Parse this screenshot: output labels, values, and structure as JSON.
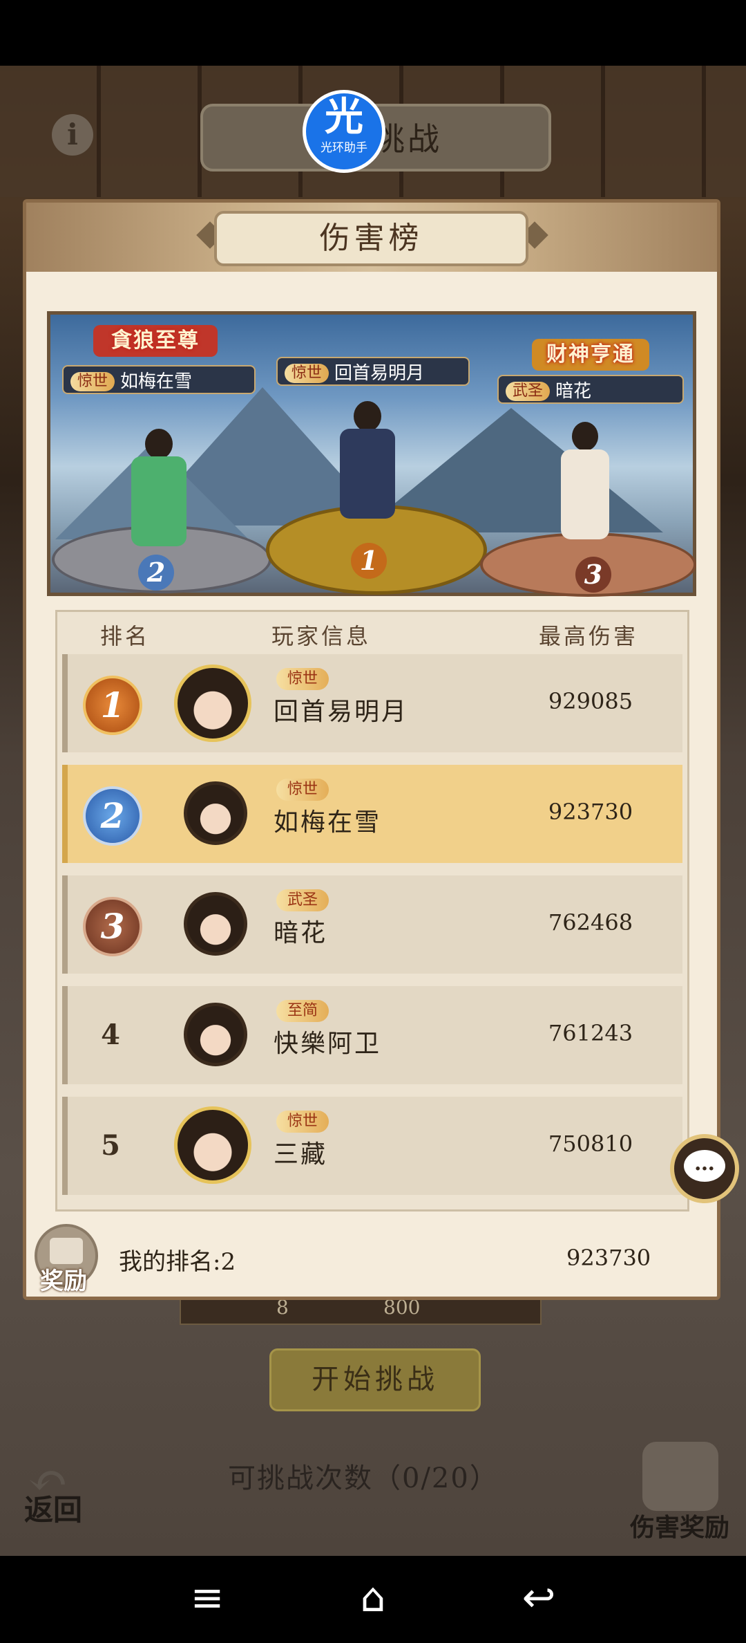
{
  "logo": {
    "big": "光",
    "small": "光环助手"
  },
  "background": {
    "title": "挑战",
    "stat_1": "8",
    "stat_2": "800",
    "start_label": "开始挑战",
    "challenge_count": "可挑战次数（0/20）",
    "back_label": "返回",
    "damage_reward_label": "伤害奖励"
  },
  "panel": {
    "title": "伤害榜",
    "podium": {
      "first": {
        "tag": "惊世",
        "name": "回首易明月",
        "medal": "1"
      },
      "second": {
        "tag": "惊世",
        "name": "如梅在雪",
        "medal": "2",
        "banner": "貪狼至尊"
      },
      "third": {
        "tag": "武圣",
        "name": "暗花",
        "medal": "3",
        "banner": "财神亨通"
      }
    },
    "columns": {
      "rank": "排名",
      "player": "玩家信息",
      "damage": "最高伤害"
    },
    "rows": [
      {
        "rank": "1",
        "tag": "惊世",
        "name": "回首易明月",
        "damage": "929085"
      },
      {
        "rank": "2",
        "tag": "惊世",
        "name": "如梅在雪",
        "damage": "923730"
      },
      {
        "rank": "3",
        "tag": "武圣",
        "name": "暗花",
        "damage": "762468"
      },
      {
        "rank": "4",
        "tag": "至简",
        "name": "快樂阿卫",
        "damage": "761243"
      },
      {
        "rank": "5",
        "tag": "惊世",
        "name": "三藏",
        "damage": "750810"
      }
    ],
    "my_rank": "我的排名:2",
    "my_damage": "923730",
    "reward_label": "奖励"
  },
  "chat": {
    "icon": "chat-bubble-icon",
    "glyph": "…"
  },
  "navbar": {
    "menu_glyph": "≡",
    "home_glyph": "⌂",
    "back_glyph": "↩"
  }
}
